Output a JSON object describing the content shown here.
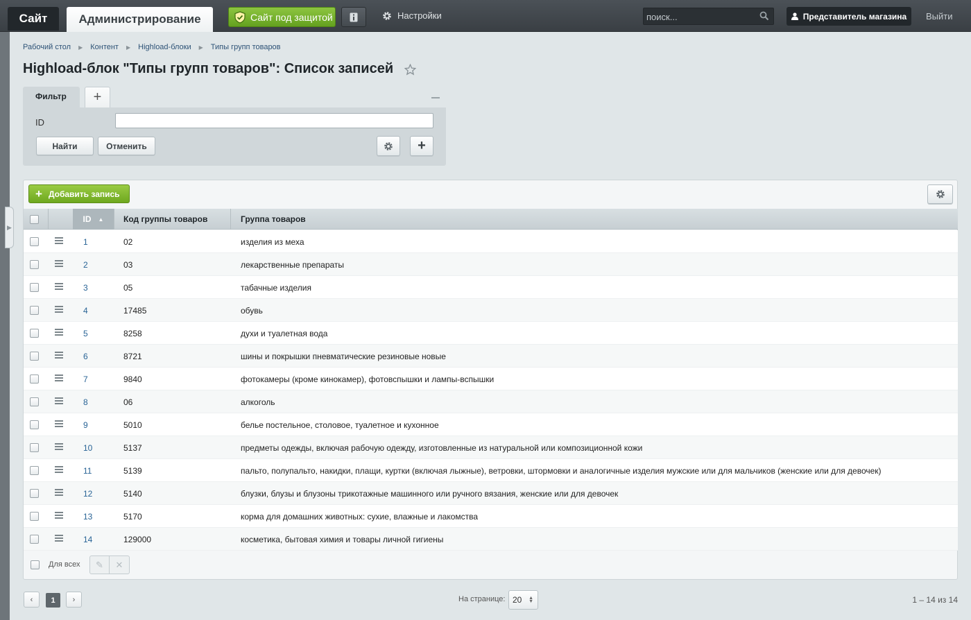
{
  "topbar": {
    "site_tab": "Сайт",
    "admin_tab": "Администрирование",
    "protect_label": "Сайт под защитой",
    "settings_label": "Настройки",
    "search_placeholder": "поиск...",
    "user_label": "Представитель магазина",
    "logout_label": "Выйти"
  },
  "breadcrumb": [
    "Рабочий стол",
    "Контент",
    "Highload-блоки",
    "Типы групп товаров"
  ],
  "page_title": "Highload-блок \"Типы групп товаров\": Список записей",
  "filter": {
    "tab_label": "Фильтр",
    "id_label": "ID",
    "id_value": "",
    "find_label": "Найти",
    "cancel_label": "Отменить"
  },
  "list": {
    "add_label": "Добавить запись",
    "columns": {
      "id": "ID",
      "code": "Код группы товаров",
      "group": "Группа товаров"
    },
    "rows": [
      {
        "id": "1",
        "code": "02",
        "group": "изделия из меха"
      },
      {
        "id": "2",
        "code": "03",
        "group": "лекарственные препараты"
      },
      {
        "id": "3",
        "code": "05",
        "group": "табачные изделия"
      },
      {
        "id": "4",
        "code": "17485",
        "group": "обувь"
      },
      {
        "id": "5",
        "code": "8258",
        "group": "духи и туалетная вода"
      },
      {
        "id": "6",
        "code": "8721",
        "group": "шины и покрышки пневматические резиновые новые"
      },
      {
        "id": "7",
        "code": "9840",
        "group": "фотокамеры (кроме кинокамер), фотовспышки и лампы-вспышки"
      },
      {
        "id": "8",
        "code": "06",
        "group": "алкоголь"
      },
      {
        "id": "9",
        "code": "5010",
        "group": "белье постельное, столовое, туалетное и кухонное"
      },
      {
        "id": "10",
        "code": "5137",
        "group": "предметы одежды, включая рабочую одежду, изготовленные из натуральной или композиционной кожи"
      },
      {
        "id": "11",
        "code": "5139",
        "group": "пальто, полупальто, накидки, плащи, куртки (включая лыжные), ветровки, штормовки и аналогичные изделия мужские или для мальчиков (женские или для девочек)"
      },
      {
        "id": "12",
        "code": "5140",
        "group": "блузки, блузы и блузоны трикотажные машинного или ручного вязания, женские или для девочек"
      },
      {
        "id": "13",
        "code": "5170",
        "group": "корма для домашних животных: сухие, влажные и лакомства"
      },
      {
        "id": "14",
        "code": "129000",
        "group": "косметика, бытовая химия и товары личной гигиены"
      }
    ],
    "for_all_label": "Для всех"
  },
  "pagination": {
    "current_page": "1",
    "per_page_label": "На странице:",
    "per_page_value": "20",
    "total_label": "1 – 14 из 14"
  },
  "colors": {
    "accent_green": "#6ea81f",
    "link_blue": "#2a6496",
    "topbar": "#3a3f44"
  }
}
